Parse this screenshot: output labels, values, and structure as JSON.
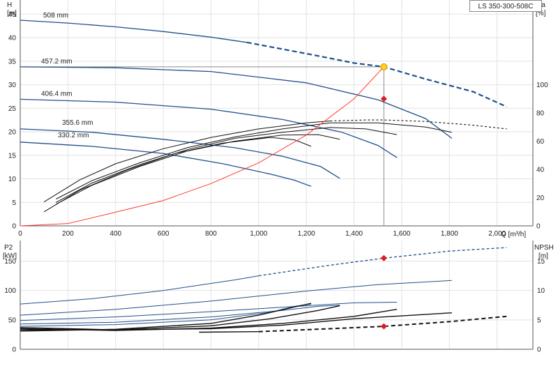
{
  "pump_label": "LS 350-300-508C",
  "colors": {
    "curve": "#1f4f8a",
    "system": "#ff3b30",
    "dark": "#111111",
    "marker_fill": "#ffd21e",
    "marker_stroke": "#e08a00",
    "red": "#e41a1c"
  },
  "chart_data": [
    {
      "type": "line",
      "title": "",
      "left_axis": {
        "label": [
          "H",
          "[m]"
        ],
        "ylim": [
          0,
          48
        ],
        "ticks": [
          0,
          5,
          10,
          15,
          20,
          25,
          30,
          35,
          40,
          45
        ]
      },
      "right_axis": {
        "label": [
          "eta",
          "[%]"
        ],
        "ylim": [
          0,
          160
        ],
        "ticks": [
          0,
          20,
          40,
          60,
          80,
          100
        ]
      },
      "xlabel": "Q [m³/h]",
      "xlim": [
        0,
        2150
      ],
      "xticks": [
        0,
        200,
        400,
        600,
        800,
        1000,
        1200,
        1400,
        1600,
        1800,
        2000
      ],
      "xtick_labels": [
        "0",
        "200",
        "400",
        "600",
        "800",
        "1,000",
        "1,200",
        "1,400",
        "1,600",
        "1,800",
        "2,000"
      ],
      "grid": true,
      "head_curves": [
        {
          "name": "508 mm",
          "solid": [
            [
              0,
              43.7
            ],
            [
              200,
              43.1
            ],
            [
              400,
              42.3
            ],
            [
              600,
              41.3
            ],
            [
              800,
              40.1
            ],
            [
              950,
              39.0
            ]
          ],
          "dashed": [
            [
              950,
              39.0
            ],
            [
              1200,
              36.6
            ],
            [
              1400,
              34.6
            ],
            [
              1525,
              33.8
            ],
            [
              1700,
              31.2
            ],
            [
              1900,
              28.5
            ],
            [
              2040,
              25.3
            ]
          ]
        },
        {
          "name": "457.2 mm",
          "solid": [
            [
              0,
              33.8
            ],
            [
              400,
              33.6
            ],
            [
              800,
              32.8
            ],
            [
              1200,
              30.4
            ],
            [
              1500,
              26.8
            ],
            [
              1700,
              22.8
            ],
            [
              1810,
              18.6
            ]
          ]
        },
        {
          "name": "406.4 mm",
          "solid": [
            [
              0,
              26.9
            ],
            [
              400,
              26.3
            ],
            [
              800,
              24.8
            ],
            [
              1100,
              22.6
            ],
            [
              1350,
              19.9
            ],
            [
              1500,
              17.1
            ],
            [
              1580,
              14.5
            ]
          ]
        },
        {
          "name": "355.6 mm",
          "solid": [
            [
              0,
              20.6
            ],
            [
              300,
              19.9
            ],
            [
              600,
              18.4
            ],
            [
              900,
              16.6
            ],
            [
              1100,
              14.8
            ],
            [
              1260,
              12.6
            ],
            [
              1340,
              10.1
            ]
          ]
        },
        {
          "name": "330.2 mm",
          "solid": [
            [
              0,
              17.8
            ],
            [
              300,
              16.9
            ],
            [
              600,
              15.4
            ],
            [
              850,
              13.2
            ],
            [
              1050,
              11.0
            ],
            [
              1150,
              9.7
            ],
            [
              1220,
              8.4
            ]
          ]
        }
      ],
      "efficiency_curves": [
        {
          "solid": [
            [
              100,
              5.1
            ],
            [
              250,
              9.8
            ],
            [
              400,
              13.2
            ],
            [
              600,
              16.4
            ],
            [
              800,
              18.8
            ],
            [
              1000,
              20.6
            ],
            [
              1200,
              21.9
            ],
            [
              1300,
              22.3
            ]
          ],
          "dashed": [
            [
              1300,
              22.3
            ],
            [
              1450,
              22.5
            ],
            [
              1525,
              22.5
            ],
            [
              1700,
              22.2
            ],
            [
              1900,
              21.4
            ],
            [
              2040,
              20.6
            ]
          ]
        },
        {
          "solid": [
            [
              150,
              5.7
            ],
            [
              300,
              9.6
            ],
            [
              500,
              13.4
            ],
            [
              700,
              16.6
            ],
            [
              900,
              18.9
            ],
            [
              1100,
              20.6
            ],
            [
              1300,
              21.9
            ],
            [
              1500,
              21.9
            ],
            [
              1700,
              21.0
            ],
            [
              1810,
              19.9
            ]
          ]
        },
        {
          "solid": [
            [
              150,
              5.0
            ],
            [
              300,
              9.1
            ],
            [
              500,
              13.0
            ],
            [
              700,
              16.2
            ],
            [
              900,
              18.6
            ],
            [
              1100,
              19.9
            ],
            [
              1300,
              20.9
            ],
            [
              1450,
              20.6
            ],
            [
              1580,
              19.4
            ]
          ]
        },
        {
          "solid": [
            [
              150,
              4.6
            ],
            [
              300,
              8.6
            ],
            [
              500,
              12.6
            ],
            [
              700,
              15.9
            ],
            [
              900,
              18.0
            ],
            [
              1100,
              19.3
            ],
            [
              1250,
              19.4
            ],
            [
              1340,
              18.4
            ]
          ]
        },
        {
          "solid": [
            [
              100,
              3.0
            ],
            [
              250,
              7.6
            ],
            [
              450,
              11.9
            ],
            [
              650,
              15.4
            ],
            [
              850,
              17.6
            ],
            [
              1050,
              18.8
            ],
            [
              1150,
              18.3
            ],
            [
              1220,
              16.9
            ]
          ]
        }
      ],
      "system_curve": [
        [
          0,
          0
        ],
        [
          200,
          0.5
        ],
        [
          400,
          2.9
        ],
        [
          600,
          5.4
        ],
        [
          800,
          9.0
        ],
        [
          1000,
          13.4
        ],
        [
          1200,
          19.3
        ],
        [
          1400,
          27.0
        ],
        [
          1525,
          33.8
        ]
      ],
      "duty_point": {
        "q": 1525,
        "h": 33.8
      },
      "eta_point": {
        "q": 1525,
        "eta": 90
      }
    },
    {
      "type": "line",
      "title": "",
      "left_axis": {
        "label": [
          "P2",
          "[kW]"
        ],
        "ylim": [
          0,
          185
        ],
        "ticks": [
          0,
          50,
          100,
          150
        ]
      },
      "right_axis": {
        "label": [
          "NPSH",
          "[m]"
        ],
        "ylim": [
          0,
          18.5
        ],
        "ticks": [
          0,
          5,
          10,
          15
        ]
      },
      "xlim": [
        0,
        2150
      ],
      "grid": true,
      "power_curves": [
        {
          "solid": [
            [
              0,
              77
            ],
            [
              300,
              86
            ],
            [
              600,
              100
            ],
            [
              900,
              118
            ],
            [
              1000,
              125
            ]
          ],
          "dashed": [
            [
              1000,
              125
            ],
            [
              1300,
              143
            ],
            [
              1525,
              155
            ],
            [
              1800,
              167
            ],
            [
              2040,
              173
            ]
          ]
        },
        {
          "solid": [
            [
              0,
              58
            ],
            [
              400,
              68
            ],
            [
              800,
              82
            ],
            [
              1200,
              99
            ],
            [
              1500,
              110
            ],
            [
              1810,
              117
            ]
          ]
        },
        {
          "solid": [
            [
              0,
              49
            ],
            [
              400,
              55
            ],
            [
              800,
              64
            ],
            [
              1200,
              74
            ],
            [
              1400,
              79
            ],
            [
              1580,
              80
            ]
          ]
        },
        {
          "solid": [
            [
              0,
              43
            ],
            [
              400,
              46
            ],
            [
              800,
              55
            ],
            [
              1100,
              66
            ],
            [
              1250,
              73
            ],
            [
              1340,
              75
            ]
          ]
        },
        {
          "solid": [
            [
              0,
              39
            ],
            [
              400,
              42
            ],
            [
              800,
              50
            ],
            [
              1050,
              63
            ],
            [
              1150,
              73
            ],
            [
              1220,
              77
            ]
          ]
        }
      ],
      "npsh_curves": [
        {
          "solid": [
            [
              750,
              2.9
            ],
            [
              1000,
              3.0
            ]
          ],
          "dashed": [
            [
              1000,
              3.0
            ],
            [
              1300,
              3.5
            ],
            [
              1525,
              3.9
            ],
            [
              1800,
              4.7
            ],
            [
              2040,
              5.6
            ]
          ]
        },
        {
          "solid": [
            [
              0,
              3.7
            ],
            [
              400,
              3.3
            ],
            [
              800,
              3.5
            ],
            [
              1100,
              4.1
            ],
            [
              1400,
              5.2
            ],
            [
              1810,
              6.2
            ]
          ]
        },
        {
          "solid": [
            [
              0,
              3.5
            ],
            [
              400,
              3.2
            ],
            [
              800,
              3.6
            ],
            [
              1100,
              4.4
            ],
            [
              1400,
              5.6
            ],
            [
              1580,
              6.8
            ]
          ]
        },
        {
          "solid": [
            [
              0,
              3.3
            ],
            [
              400,
              3.3
            ],
            [
              800,
              4.0
            ],
            [
              1050,
              5.2
            ],
            [
              1250,
              6.6
            ],
            [
              1340,
              7.4
            ]
          ]
        },
        {
          "solid": [
            [
              0,
              3.1
            ],
            [
              400,
              3.4
            ],
            [
              800,
              4.4
            ],
            [
              1000,
              5.8
            ],
            [
              1150,
              7.2
            ],
            [
              1220,
              7.8
            ]
          ]
        }
      ],
      "power_point": {
        "q": 1525,
        "p": 155
      },
      "npsh_point": {
        "q": 1525,
        "npsh": 3.9
      }
    }
  ]
}
